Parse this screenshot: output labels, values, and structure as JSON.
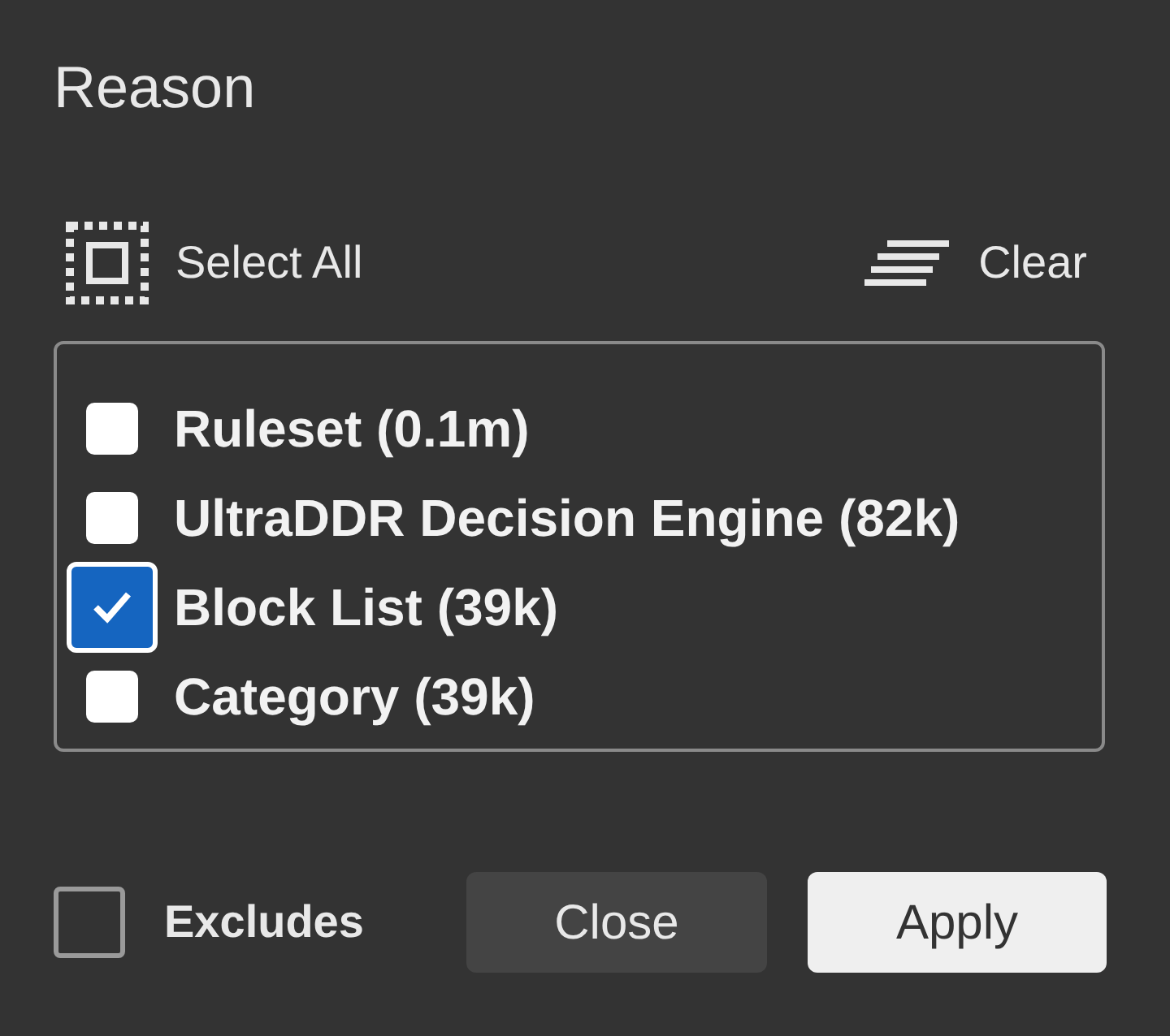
{
  "title": "Reason",
  "actions": {
    "select_all": "Select All",
    "clear": "Clear"
  },
  "options": [
    {
      "label": "Ruleset (0.1m)",
      "checked": false
    },
    {
      "label": "UltraDDR Decision Engine (82k)",
      "checked": false
    },
    {
      "label": "Block List (39k)",
      "checked": true
    },
    {
      "label": "Category (39k)",
      "checked": false
    }
  ],
  "excludes": {
    "label": "Excludes",
    "checked": false
  },
  "buttons": {
    "close": "Close",
    "apply": "Apply"
  }
}
